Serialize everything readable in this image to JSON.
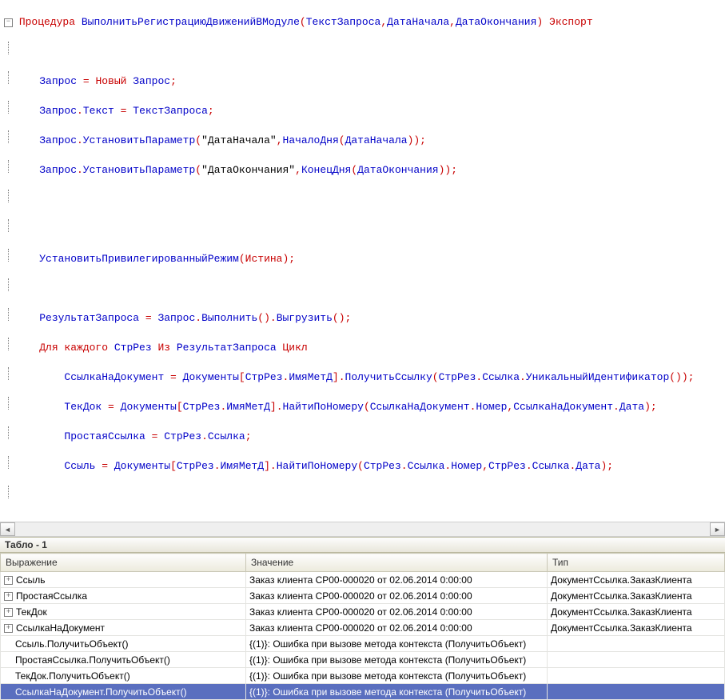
{
  "code": {
    "l1": {
      "kw1": "Процедура",
      "id1": "ВыполнитьРегистрациюДвиженийВМодуле",
      "p": "(",
      "a1": "ТекстЗапроса",
      "c1": ",",
      "a2": "ДатаНачала",
      "c2": ",",
      "a3": "ДатаОкончания",
      "p2": ")",
      "exp": "Экспорт"
    },
    "l2": {
      "pre": "    ",
      "a": "Запрос",
      "eq": " = ",
      "nw": "Новый ",
      "b": "Запрос",
      "sc": ";"
    },
    "l3": {
      "pre": "    ",
      "a": "Запрос",
      "d": ".",
      "b": "Текст",
      "eq": " = ",
      "c": "ТекстЗапроса",
      "sc": ";"
    },
    "l4": {
      "pre": "    ",
      "a": "Запрос",
      "d": ".",
      "m": "УстановитьПараметр",
      "p": "(",
      "s": "\"ДатаНачала\"",
      "c": ",",
      "fn": "НачалоДня",
      "p2": "(",
      "ar": "ДатаНачала",
      "p3": "));"
    },
    "l5": {
      "pre": "    ",
      "a": "Запрос",
      "d": ".",
      "m": "УстановитьПараметр",
      "p": "(",
      "s": "\"ДатаОкончания\"",
      "c": ",",
      "fn": "КонецДня",
      "p2": "(",
      "ar": "ДатаОкончания",
      "p3": "));"
    },
    "l6": {
      "pre": "    ",
      "fn": "УстановитьПривилегированныйРежим",
      "p": "(",
      "ar": "Истина",
      "p2": ");"
    },
    "l7": {
      "pre": "    ",
      "a": "РезультатЗапроса",
      "eq": " = ",
      "b": "Запрос",
      "d": ".",
      "m": "Выполнить",
      "p": "().",
      "m2": "Выгрузить",
      "p2": "();"
    },
    "l8": {
      "pre": "    ",
      "kw1": "Для каждого ",
      "a": "СтрРез ",
      "kw2": "Из ",
      "b": "РезультатЗапроса ",
      "kw3": "Цикл"
    },
    "l9": {
      "pre": "        ",
      "a": "СсылкаНаДокумент",
      "eq": " = ",
      "b": "Документы",
      "br": "[",
      "c": "СтрРез",
      "d": ".",
      "e": "ИмяМетД",
      "br2": "].",
      "m": "ПолучитьСсылку",
      "p": "(",
      "c2": "СтрРез",
      "d2": ".",
      "e2": "Ссылка",
      "d3": ".",
      "m2": "УникальныйИдентификатор",
      "p2": "());"
    },
    "l10": {
      "pre": "        ",
      "a": "ТекДок",
      "eq": " = ",
      "b": "Документы",
      "br": "[",
      "c": "СтрРез",
      "d": ".",
      "e": "ИмяМетД",
      "br2": "].",
      "m": "НайтиПоНомеру",
      "p": "(",
      "c2": "СсылкаНаДокумент",
      "d2": ".",
      "e2": "Номер",
      "cm": ",",
      "c3": "СсылкаНаДокумент",
      "d3": ".",
      "e3": "Дата",
      "p2": ");"
    },
    "l11": {
      "pre": "        ",
      "a": "ПростаяСсылка",
      "eq": " = ",
      "b": "СтрРез",
      "d": ".",
      "c": "Ссылка",
      "sc": ";"
    },
    "l12": {
      "pre": "        ",
      "a": "Ссыль",
      "eq": " = ",
      "b": "Документы",
      "br": "[",
      "c": "СтрРез",
      "d": ".",
      "e": "ИмяМетД",
      "br2": "].",
      "m": "НайтиПоНомеру",
      "p": "(",
      "c2": "СтрРез",
      "d2": ".",
      "e2": "Ссылка",
      "d3": ".",
      "e3": "Номер",
      "cm": ",",
      "c3": "СтрРез",
      "d4": ".",
      "e4": "Ссылка",
      "d5": ".",
      "e5": "Дата",
      "p2": ");"
    }
  },
  "tablo": {
    "title": "Табло - 1",
    "columns": {
      "expr": "Выражение",
      "value": "Значение",
      "type": "Тип"
    },
    "rows": [
      {
        "expand": true,
        "expr": "Ссыль",
        "value": "Заказ клиента СР00-000020 от 02.06.2014 0:00:00",
        "type": "ДокументСсылка.ЗаказКлиента",
        "sel": false
      },
      {
        "expand": true,
        "expr": "ПростаяСсылка",
        "value": "Заказ клиента СР00-000020 от 02.06.2014 0:00:00",
        "type": "ДокументСсылка.ЗаказКлиента",
        "sel": false
      },
      {
        "expand": true,
        "expr": "ТекДок",
        "value": "Заказ клиента СР00-000020 от 02.06.2014 0:00:00",
        "type": "ДокументСсылка.ЗаказКлиента",
        "sel": false
      },
      {
        "expand": true,
        "expr": "СсылкаНаДокумент",
        "value": "Заказ клиента СР00-000020 от 02.06.2014 0:00:00",
        "type": "ДокументСсылка.ЗаказКлиента",
        "sel": false
      },
      {
        "expand": false,
        "expr": "Ссыль.ПолучитьОбъект()",
        "value": "{(1)}: Ошибка при вызове метода контекста (ПолучитьОбъект)",
        "type": "",
        "sel": false
      },
      {
        "expand": false,
        "expr": "ПростаяСсылка.ПолучитьОбъект()",
        "value": "{(1)}: Ошибка при вызове метода контекста (ПолучитьОбъект)",
        "type": "",
        "sel": false
      },
      {
        "expand": false,
        "expr": "ТекДок.ПолучитьОбъект()",
        "value": "{(1)}: Ошибка при вызове метода контекста (ПолучитьОбъект)",
        "type": "",
        "sel": false
      },
      {
        "expand": false,
        "expr": "СсылкаНаДокумент.ПолучитьОбъект()",
        "value": "{(1)}: Ошибка при вызове метода контекста (ПолучитьОбъект)",
        "type": "",
        "sel": true
      }
    ]
  }
}
